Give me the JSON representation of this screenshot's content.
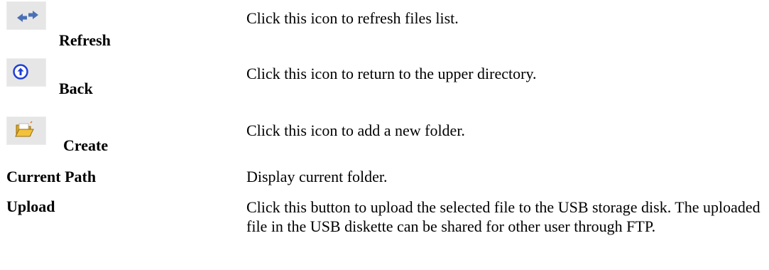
{
  "rows": [
    {
      "term": "Refresh",
      "icon": "refresh-arrows-icon",
      "desc": "Click this icon to refresh files list."
    },
    {
      "term": "Back",
      "icon": "up-arrow-circle-icon",
      "desc": "Click this icon to return to the upper directory."
    },
    {
      "term": "Create",
      "icon": "open-folder-icon",
      "desc": "Click this icon to add a new folder."
    },
    {
      "term": "Current Path",
      "desc": "Display current folder."
    },
    {
      "term": "Upload",
      "desc": "Click this button to upload the selected file to the USB storage disk. The uploaded file in the USB diskette can be shared for other user through FTP."
    }
  ],
  "colors": {
    "icon_bg": "#e6e6e6",
    "refresh_arrow": "#4a6fb5",
    "back_circle": "#1f3fd6",
    "folder_yellow": "#f2c23a"
  }
}
